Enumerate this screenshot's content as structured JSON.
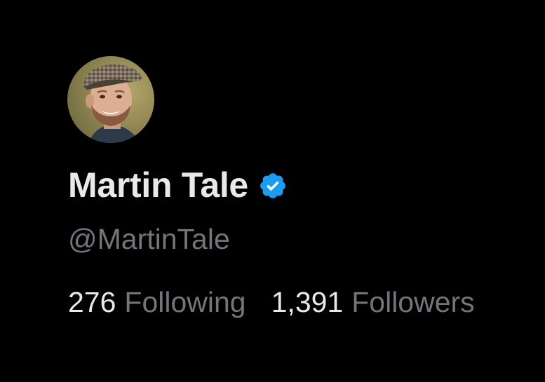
{
  "profile": {
    "display_name": "Martin Tale",
    "handle": "@MartinTale",
    "verified": true,
    "avatar_icon": "profile-photo-man-in-flat-cap"
  },
  "stats": {
    "following_count": "276",
    "following_label": "Following",
    "followers_count": "1,391",
    "followers_label": "Followers"
  },
  "colors": {
    "background": "#000000",
    "primary_text": "#e7e9ea",
    "secondary_text": "#71767b",
    "verified_badge": "#1d9bf0"
  }
}
